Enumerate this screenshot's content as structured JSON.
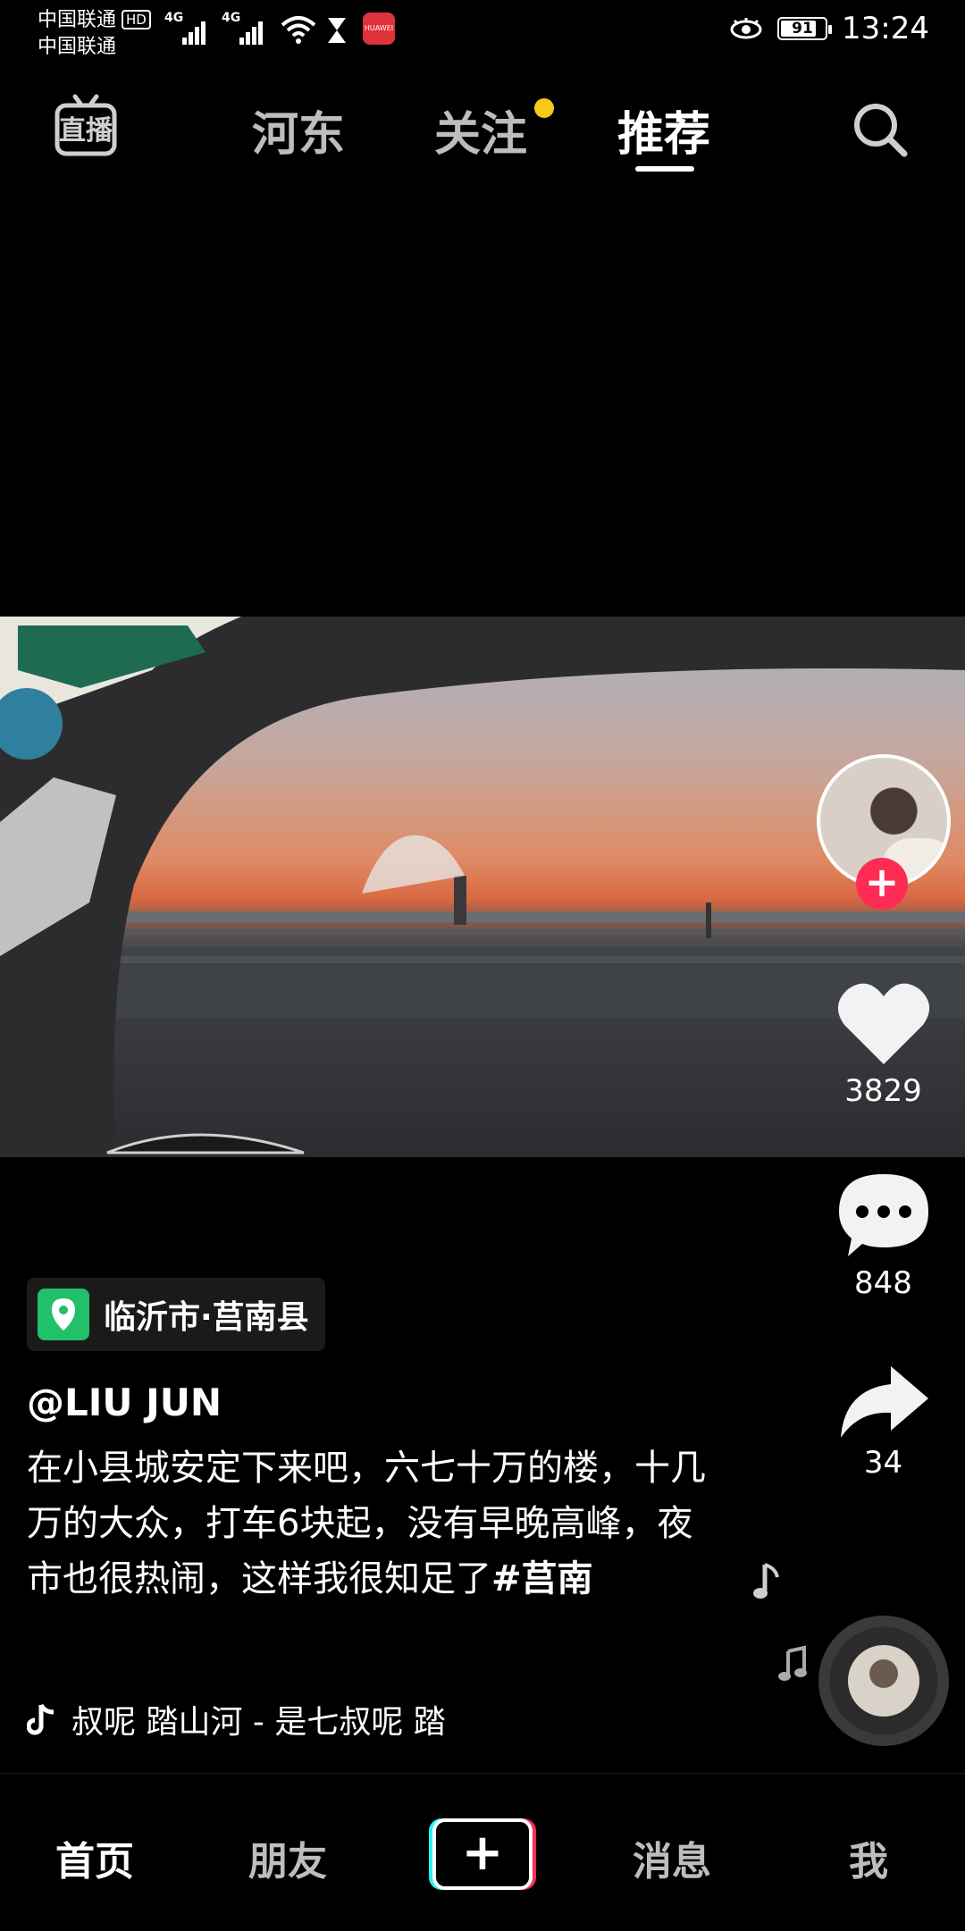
{
  "status_bar": {
    "carrier1": "中国联通",
    "carrier2": "中国联通",
    "hd_label": "HD",
    "net1": "4G",
    "net2": "4G",
    "battery": "91",
    "time": "13:24",
    "app_badge": "HUAWEI"
  },
  "top_nav": {
    "live": "直播",
    "tabs": [
      "河东",
      "关注",
      "推荐"
    ],
    "active_tab": "推荐"
  },
  "actions": {
    "likes": "3829",
    "comments": "848",
    "shares": "34"
  },
  "post": {
    "location": "临沂市·莒南县",
    "author": "@LIU JUN",
    "description": "在小县城安定下来吧，六七十万的楼，十几万的大众，打车6块起，没有早晚高峰，夜市也很热闹，这样我很知足了",
    "hashtag": "#莒南",
    "music": "叔呢    踏山河 - 是七叔呢    踏"
  },
  "bottom_nav": {
    "home": "首页",
    "friends": "朋友",
    "plus": "+",
    "messages": "消息",
    "me": "我"
  },
  "colors": {
    "accent_red": "#fe2c55",
    "accent_cyan": "#25f4ee",
    "location_green": "#21c06a",
    "dot_yellow": "#f8c81c"
  }
}
